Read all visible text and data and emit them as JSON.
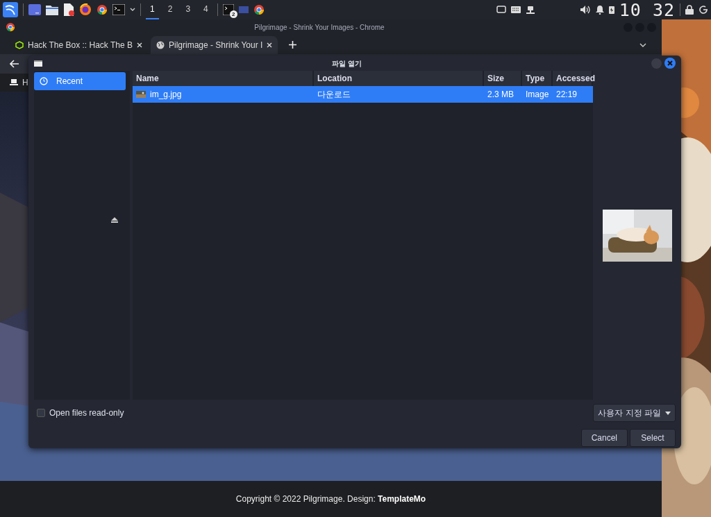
{
  "taskbar": {
    "workspaces": [
      {
        "label": "1",
        "selected": true
      },
      {
        "label": "2",
        "selected": false
      },
      {
        "label": "3",
        "selected": false
      },
      {
        "label": "4",
        "selected": false
      }
    ],
    "badge": "2",
    "clock": "10 32"
  },
  "browser": {
    "title": "Pilgrimage - Shrink Your Images - Chrome",
    "tabs": [
      {
        "label": "Hack The Box :: Hack The B",
        "selected": false
      },
      {
        "label": "Pilgrimage - Shrink Your I",
        "selected": true
      }
    ],
    "page_text": "H",
    "footer": "Copyright © 2022 Pilgrimage. Design: **TemplateMo**"
  },
  "dialog": {
    "title": "파일 열기",
    "places": [
      {
        "label": "Recent",
        "selected": true
      }
    ],
    "columns": [
      "Name",
      "Location",
      "Size",
      "Type",
      "Accessed"
    ],
    "files": [
      {
        "name": "im_g.jpg",
        "location": "다운로드",
        "size": "2.3 MB",
        "type": "Image",
        "accessed": "22:19",
        "selected": true
      }
    ],
    "read_only": {
      "label": "Open files read-only",
      "checked": false
    },
    "filter": "사용자 지정 파일",
    "buttons": [
      "Cancel",
      "Select"
    ]
  }
}
